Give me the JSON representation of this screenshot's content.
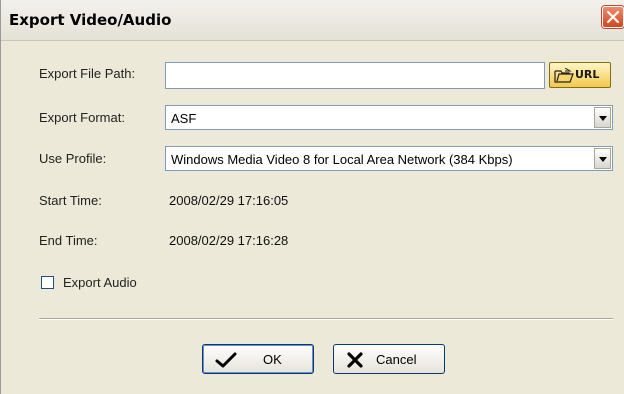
{
  "window": {
    "title": "Export Video/Audio"
  },
  "form": {
    "file_path": {
      "label": "Export File Path:",
      "value": "",
      "button_label": "URL"
    },
    "format": {
      "label": "Export Format:",
      "value": "ASF"
    },
    "profile": {
      "label": "Use Profile:",
      "value": "Windows Media Video 8 for Local Area Network (384 Kbps)"
    },
    "start_time": {
      "label": "Start Time:",
      "value": "2008/02/29 17:16:05"
    },
    "end_time": {
      "label": "End Time:",
      "value": "2008/02/29 17:16:28"
    },
    "export_audio": {
      "label": "Export Audio",
      "checked": false
    }
  },
  "buttons": {
    "ok_label": "OK",
    "cancel_label": "Cancel"
  },
  "icons": {
    "close": "close-icon",
    "folder": "folder-open-icon",
    "ok": "checkmark-icon",
    "cancel": "x-mark-icon"
  },
  "colors": {
    "dialog_bg": "#ece9d8",
    "close_button": "#d4451f",
    "url_button": "#f2c94b",
    "input_border": "#7f9db9"
  }
}
